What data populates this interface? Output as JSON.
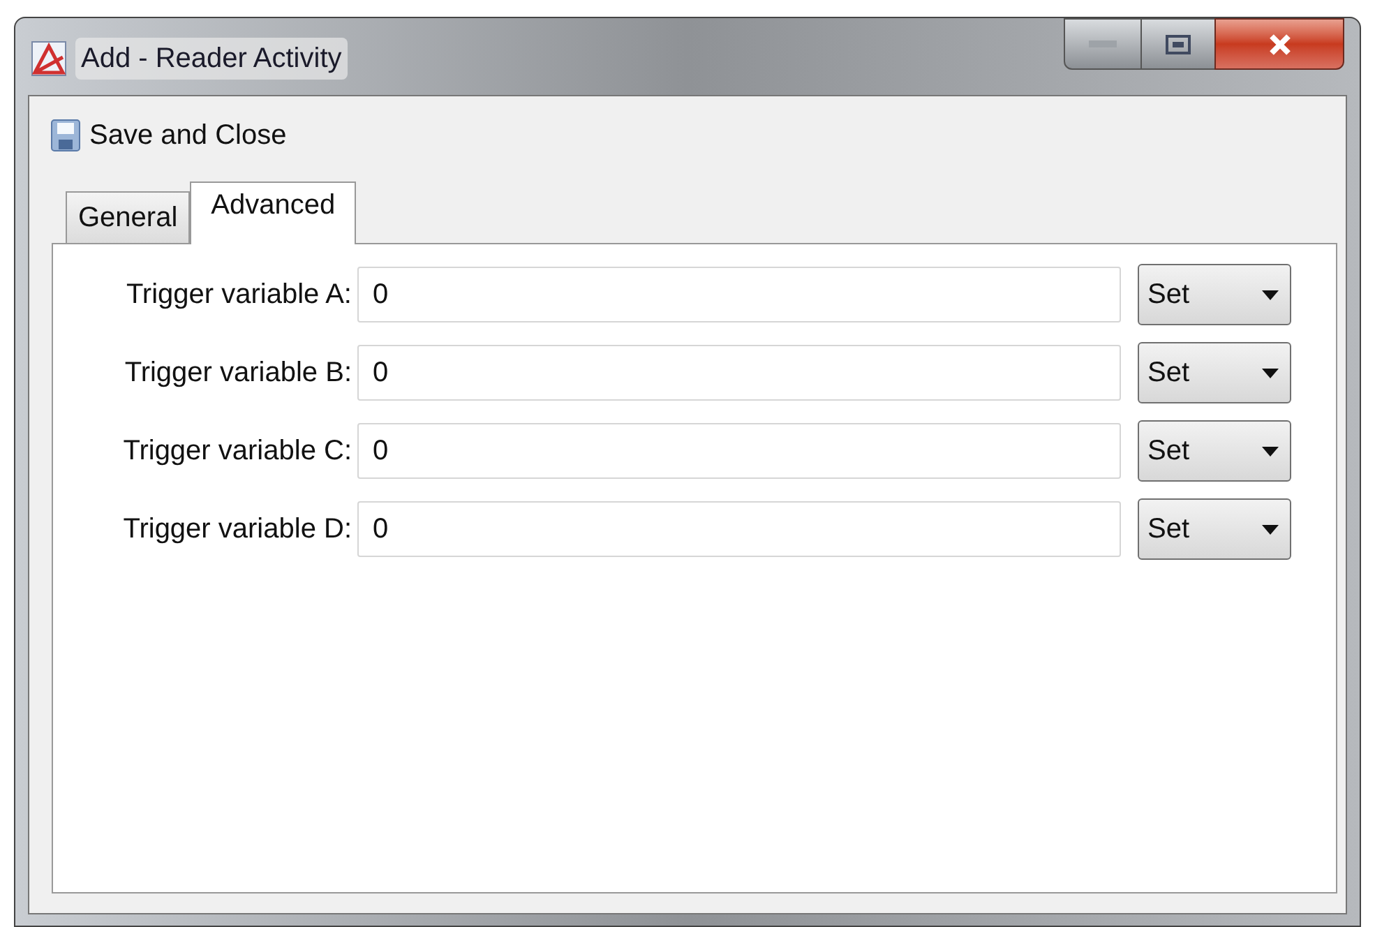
{
  "window": {
    "title": "Add - Reader Activity"
  },
  "toolbar": {
    "save_button": "Save and Close"
  },
  "tabs": [
    {
      "label": "General",
      "selected": false
    },
    {
      "label": "Advanced",
      "selected": true
    }
  ],
  "fields": [
    {
      "label": "Trigger variable A:",
      "value": "0",
      "mode": "Set"
    },
    {
      "label": "Trigger variable B:",
      "value": "0",
      "mode": "Set"
    },
    {
      "label": "Trigger variable C:",
      "value": "0",
      "mode": "Set"
    },
    {
      "label": "Trigger variable D:",
      "value": "0",
      "mode": "Set"
    }
  ]
}
